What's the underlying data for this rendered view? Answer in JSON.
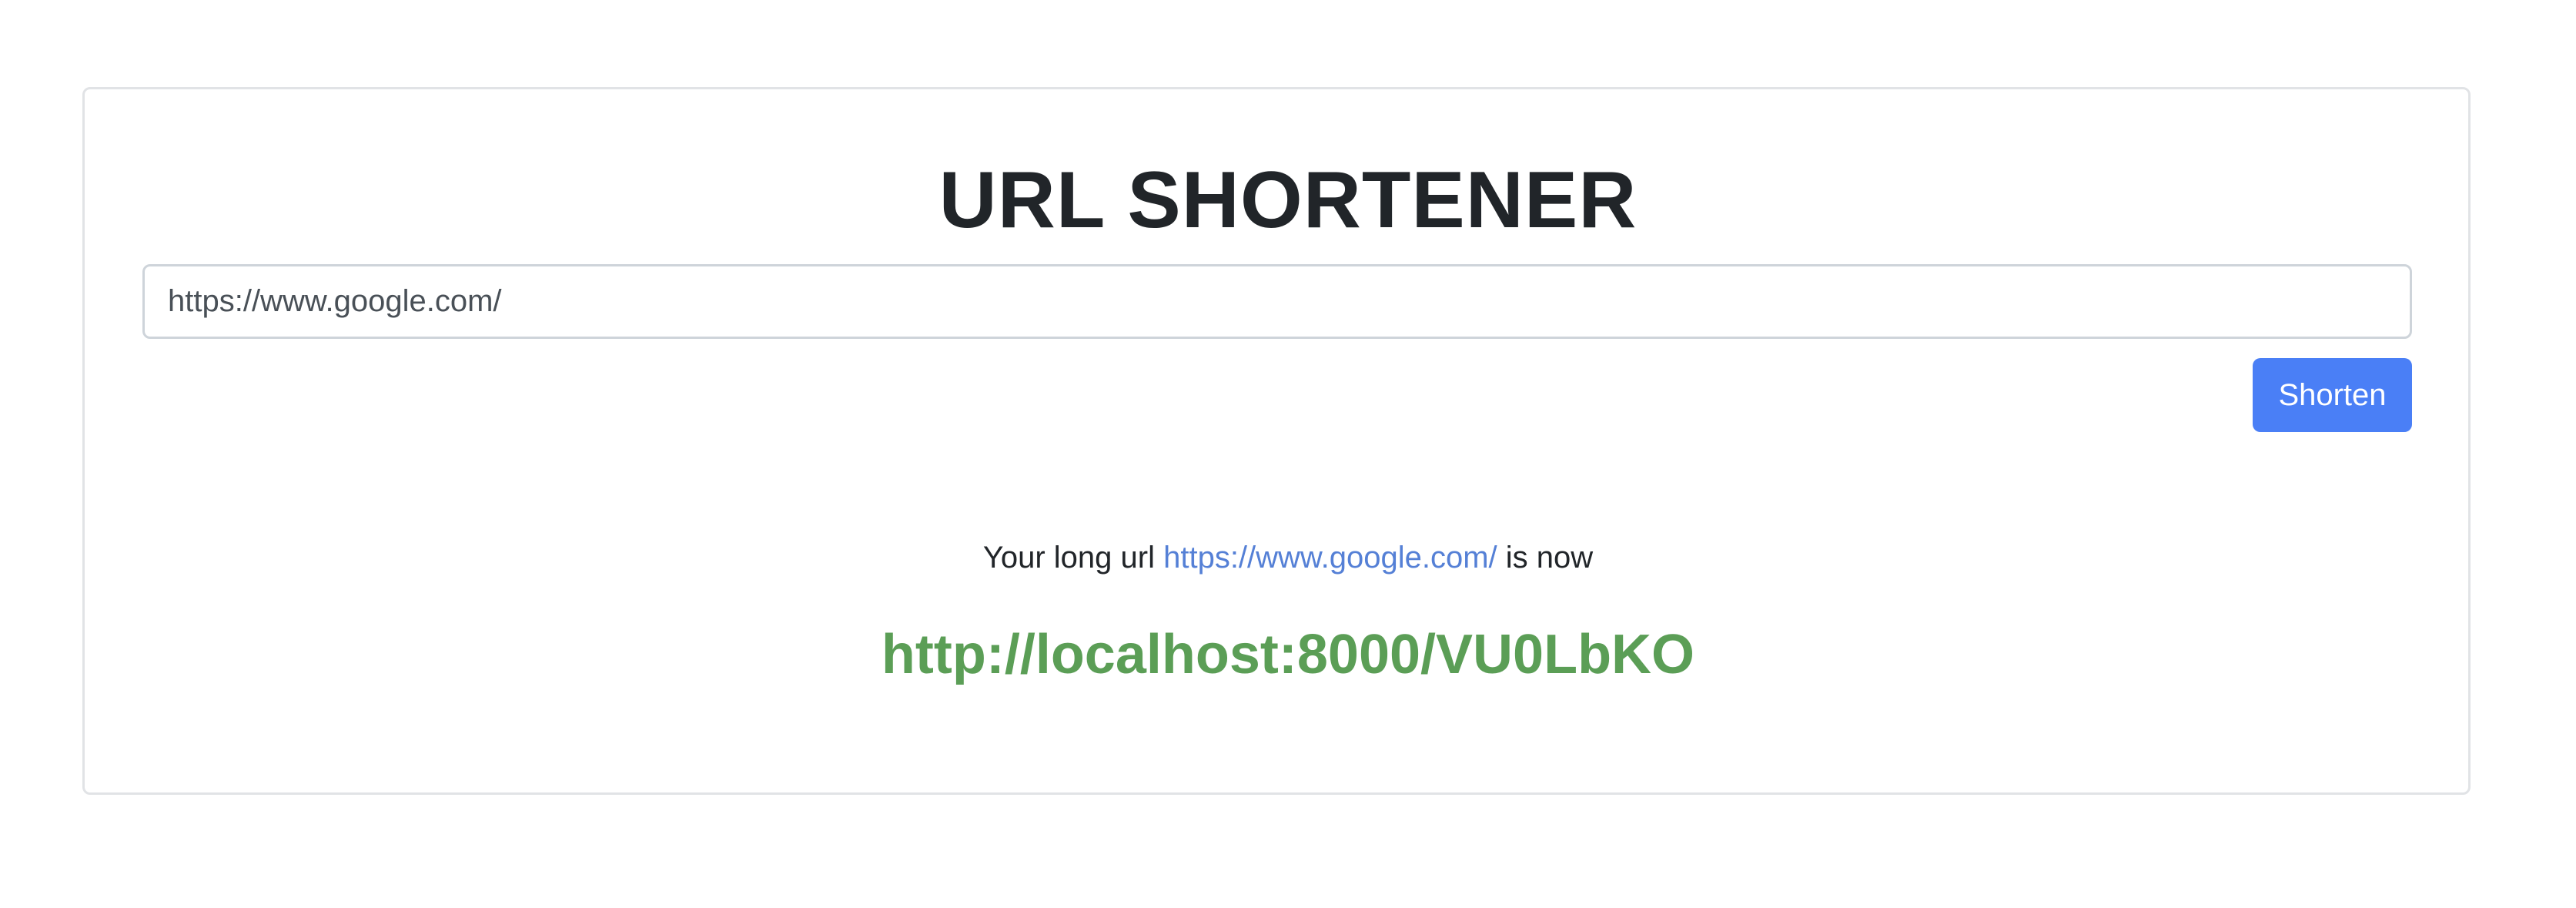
{
  "app": {
    "title": "URL SHORTENER"
  },
  "form": {
    "input_value": "https://www.google.com/",
    "shorten_label": "Shorten"
  },
  "result": {
    "prefix": "Your long url",
    "long_url": "https://www.google.com/",
    "suffix": "is now",
    "short_url": "http://localhost:8000/VU0LbKO"
  },
  "colors": {
    "button": "#4a7ff6",
    "link": "#5580d6",
    "short_url": "#5b9e56",
    "border": "#e1e3e6"
  }
}
